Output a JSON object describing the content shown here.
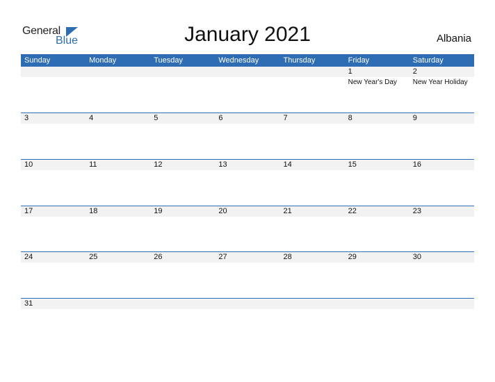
{
  "logo": {
    "general": "General",
    "blue": "Blue"
  },
  "title": "January 2021",
  "country": "Albania",
  "colors": {
    "accent": "#2e6db4",
    "shade": "#f2f2f2"
  },
  "weekdays": [
    "Sunday",
    "Monday",
    "Tuesday",
    "Wednesday",
    "Thursday",
    "Friday",
    "Saturday"
  ],
  "weeks": [
    [
      {
        "day": ""
      },
      {
        "day": ""
      },
      {
        "day": ""
      },
      {
        "day": ""
      },
      {
        "day": ""
      },
      {
        "day": "1",
        "holiday": "New Year's Day"
      },
      {
        "day": "2",
        "holiday": "New Year Holiday"
      }
    ],
    [
      {
        "day": "3"
      },
      {
        "day": "4"
      },
      {
        "day": "5"
      },
      {
        "day": "6"
      },
      {
        "day": "7"
      },
      {
        "day": "8"
      },
      {
        "day": "9"
      }
    ],
    [
      {
        "day": "10"
      },
      {
        "day": "11"
      },
      {
        "day": "12"
      },
      {
        "day": "13"
      },
      {
        "day": "14"
      },
      {
        "day": "15"
      },
      {
        "day": "16"
      }
    ],
    [
      {
        "day": "17"
      },
      {
        "day": "18"
      },
      {
        "day": "19"
      },
      {
        "day": "20"
      },
      {
        "day": "21"
      },
      {
        "day": "22"
      },
      {
        "day": "23"
      }
    ],
    [
      {
        "day": "24"
      },
      {
        "day": "25"
      },
      {
        "day": "26"
      },
      {
        "day": "27"
      },
      {
        "day": "28"
      },
      {
        "day": "29"
      },
      {
        "day": "30"
      }
    ],
    [
      {
        "day": "31"
      },
      {
        "day": ""
      },
      {
        "day": ""
      },
      {
        "day": ""
      },
      {
        "day": ""
      },
      {
        "day": ""
      },
      {
        "day": ""
      }
    ]
  ]
}
